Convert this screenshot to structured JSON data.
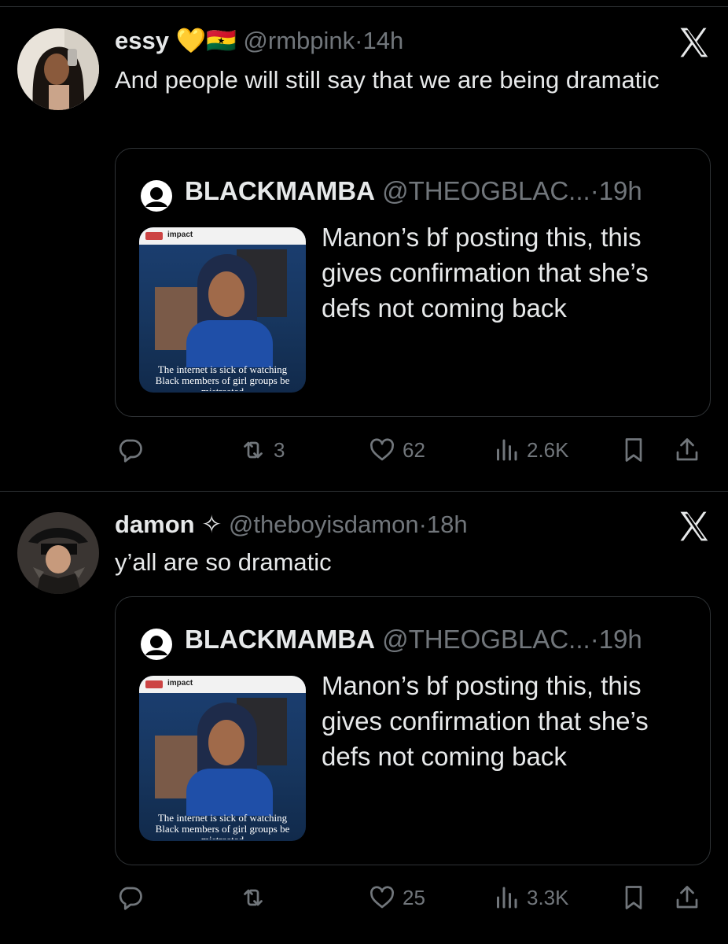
{
  "tweets": [
    {
      "name": "essy",
      "name_emoji": "💛🇬🇭",
      "handle": "@rmbpink",
      "time": "14h",
      "text": "And people will still say that we are being dramatic",
      "quote": {
        "name": "BLACKMAMBA",
        "handle": "@THEOGBLAC...",
        "time": "19h",
        "text": "Manon’s bf posting this, this gives confirmation that she’s defs not coming back",
        "image_header": "impact",
        "image_caption": "The internet is sick of watching Black members of girl groups be mistreated"
      },
      "actions": {
        "replies": "",
        "retweets": "3",
        "likes": "62",
        "views": "2.6K"
      }
    },
    {
      "name": "damon",
      "name_emoji": "✧",
      "handle": "@theboyisdamon",
      "time": "18h",
      "text": "y’all are so dramatic",
      "quote": {
        "name": "BLACKMAMBA",
        "handle": "@THEOGBLAC...",
        "time": "19h",
        "text": "Manon’s bf posting this, this gives confirmation that she’s defs not coming back",
        "image_header": "impact",
        "image_caption": "The internet is sick of watching Black members of girl groups be mistreated"
      },
      "actions": {
        "replies": "",
        "retweets": "",
        "likes": "25",
        "views": "3.3K"
      }
    }
  ],
  "colors": {
    "background": "#000000",
    "text": "#e7e9ea",
    "muted": "#71767b",
    "border": "#2f3336"
  },
  "icons": [
    "x-logo-icon",
    "reply-icon",
    "retweet-icon",
    "like-icon",
    "views-icon",
    "bookmark-icon",
    "share-icon",
    "default-avatar-icon"
  ]
}
